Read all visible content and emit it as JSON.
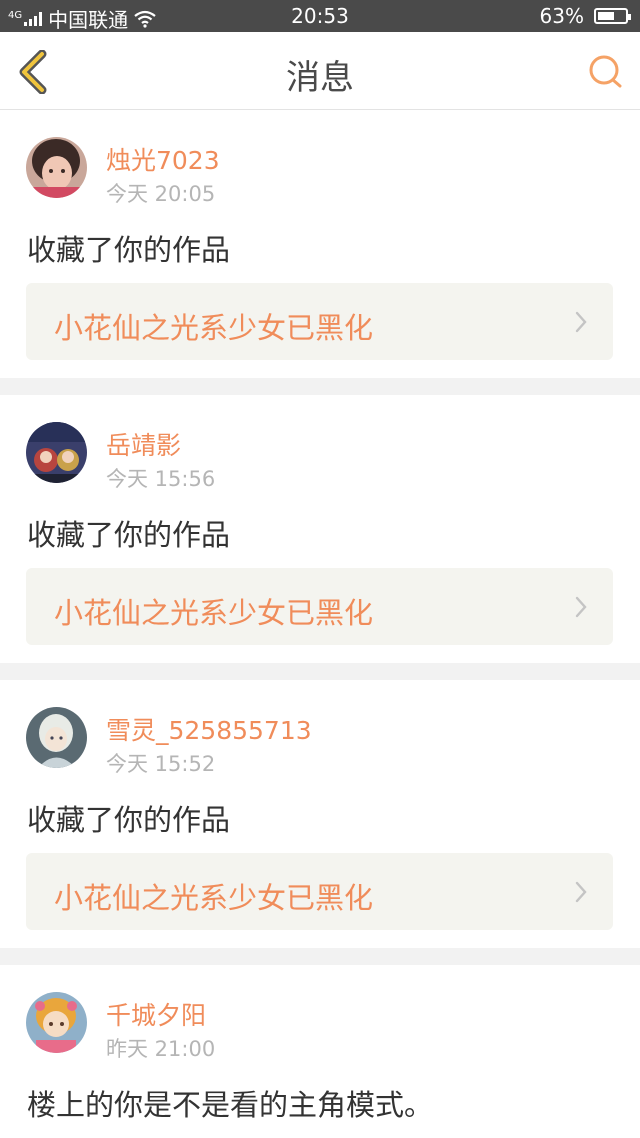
{
  "status_bar": {
    "network_type": "4G",
    "carrier": "中国联通",
    "time": "20:53",
    "battery": "63%",
    "battery_level": 0.63,
    "icons": [
      "signal-icon",
      "wifi-icon",
      "battery-icon"
    ]
  },
  "header": {
    "title": "消息",
    "back_icon": "chevron-left-icon",
    "search_icon": "search-icon",
    "accent_color": "#f0c43c",
    "search_color": "#f5a266"
  },
  "colors": {
    "username": "#f08c5a",
    "timestamp": "#b5b5b5",
    "link_background": "#f4f4ef"
  },
  "messages": [
    {
      "username": "烛光7023",
      "time": "今天 20:05",
      "text": "收藏了你的作品",
      "work_title": "小花仙之光系少女已黑化"
    },
    {
      "username": "岳靖影",
      "time": "今天 15:56",
      "text": "收藏了你的作品",
      "work_title": "小花仙之光系少女已黑化"
    },
    {
      "username": "雪灵_525855713",
      "time": "今天 15:52",
      "text": "收藏了你的作品",
      "work_title": "小花仙之光系少女已黑化"
    },
    {
      "username": "千城夕阳",
      "time": "昨天 21:00",
      "text": "楼上的你是不是看的主角模式。"
    }
  ]
}
